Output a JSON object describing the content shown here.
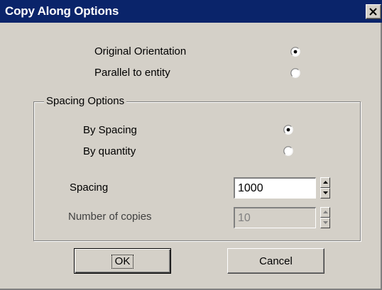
{
  "window": {
    "title": "Copy Along Options",
    "close_icon": "close-icon"
  },
  "orientation": {
    "options": [
      {
        "label": "Original Orientation",
        "checked": true
      },
      {
        "label": "Parallel to entity",
        "checked": false
      }
    ]
  },
  "spacing_group": {
    "legend": "Spacing Options",
    "options": [
      {
        "label": "By Spacing",
        "checked": true
      },
      {
        "label": "By quantity",
        "checked": false
      }
    ],
    "spacing": {
      "label": "Spacing",
      "value": "1000",
      "enabled": true
    },
    "copies": {
      "label": "Number of copies",
      "value": "10",
      "enabled": false
    }
  },
  "buttons": {
    "ok": "OK",
    "cancel": "Cancel"
  },
  "colors": {
    "titlebar": "#0a246a",
    "face": "#d4d0c8"
  }
}
